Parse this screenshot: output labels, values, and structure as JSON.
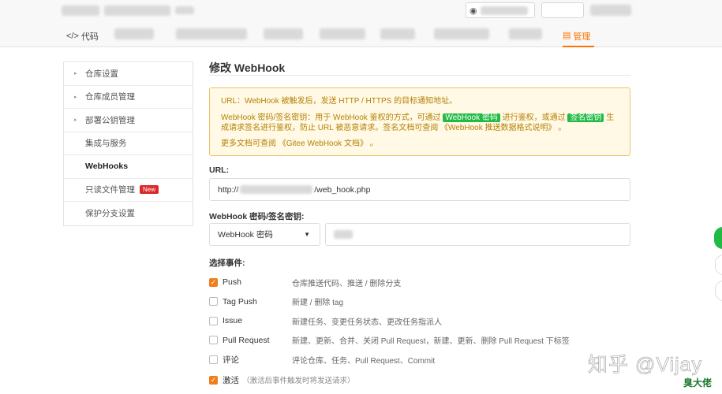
{
  "topbar": {
    "watch_icon": "eye-icon"
  },
  "tabs": {
    "code_label": "代码",
    "code_icon": "code-icon",
    "manage_label": "管理",
    "manage_icon": "settings-icon"
  },
  "sidebar": {
    "items": [
      {
        "label": "仓库设置",
        "expandable": true
      },
      {
        "label": "仓库成员管理",
        "expandable": true
      },
      {
        "label": "部署公钥管理",
        "expandable": true
      },
      {
        "label": "集成与服务",
        "expandable": false
      },
      {
        "label": "WebHooks",
        "expandable": false,
        "active": true
      },
      {
        "label": "只读文件管理",
        "expandable": false,
        "badge": "New"
      },
      {
        "label": "保护分支设置",
        "expandable": false
      }
    ]
  },
  "main": {
    "title": "修改 WebHook",
    "notice": {
      "line1": "URL：WebHook 被触发后，发送 HTTP / HTTPS 的目标通知地址。",
      "line2_a": "WebHook 密码/签名密钥：用于 WebHook 鉴权的方式，可通过",
      "chip1": "WebHook 密码",
      "line2_b": "进行鉴权，或通过",
      "chip2": "签名密钥",
      "line2_c": "生成请求签名进行鉴权，防止 URL 被恶意请求。签名文档可查阅 《WebHook 推送数据格式说明》 。",
      "line3": "更多文档可查阅 《Gitee WebHook 文档》 。"
    },
    "url_label": "URL:",
    "url_prefix": "http://",
    "url_suffix": "/web_hook.php",
    "secret_label": "WebHook 密码/签名密钥:",
    "secret_select": "WebHook 密码",
    "events_label": "选择事件:",
    "events": [
      {
        "name": "Push",
        "desc": "仓库推送代码、推送 / 删除分支",
        "checked": true
      },
      {
        "name": "Tag Push",
        "desc": "新建 / 删除 tag",
        "checked": false
      },
      {
        "name": "Issue",
        "desc": "新建任务、变更任务状态、更改任务指派人",
        "checked": false
      },
      {
        "name": "Pull Request",
        "desc": "新建、更新、合并、关闭 Pull Request，新建、更新、删除 Pull Request 下标签",
        "checked": false
      },
      {
        "name": "评论",
        "desc": "评论仓库、任务、Pull Request、Commit",
        "checked": false
      }
    ],
    "active_label": "激活",
    "active_hint": "（激活后事件触发时将发送请求）",
    "active_checked": true
  },
  "watermark": {
    "text": "知乎 @Vijay",
    "text2": "臭大佬"
  },
  "colors": {
    "accent": "#fe7300",
    "checkbox": "#f07e1b",
    "green_chip": "#21ba45",
    "notice_bg": "#fff9e6",
    "new_badge": "#db2828"
  }
}
